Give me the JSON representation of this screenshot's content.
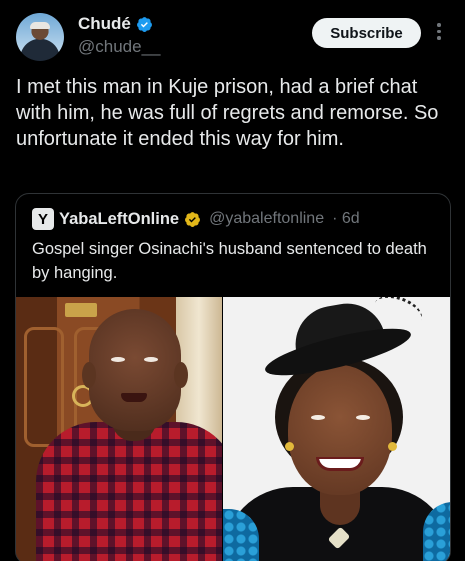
{
  "author": {
    "name": "Chudé",
    "handle": "@chude__",
    "verified": true
  },
  "subscribe_label": "Subscribe",
  "post_text": "I met this man in Kuje prison, had a brief chat with him, he was full of regrets and remorse. So unfortunate it ended this way for him.",
  "quoted": {
    "logo_letter": "Y",
    "name": "YabaLeftOnline",
    "handle": "@yabaleftonline",
    "time": "· 6d",
    "text": "Gospel singer Osinachi's husband sentenced to death by hanging.",
    "badge_color": "#e2b719"
  },
  "colors": {
    "verified_blue": "#1d9bf0",
    "background": "#000000",
    "muted_text": "#71767b"
  },
  "icons": {
    "more": "more-vertical-icon",
    "verified": "verified-badge-icon",
    "gold_badge": "gold-verified-badge-icon"
  }
}
